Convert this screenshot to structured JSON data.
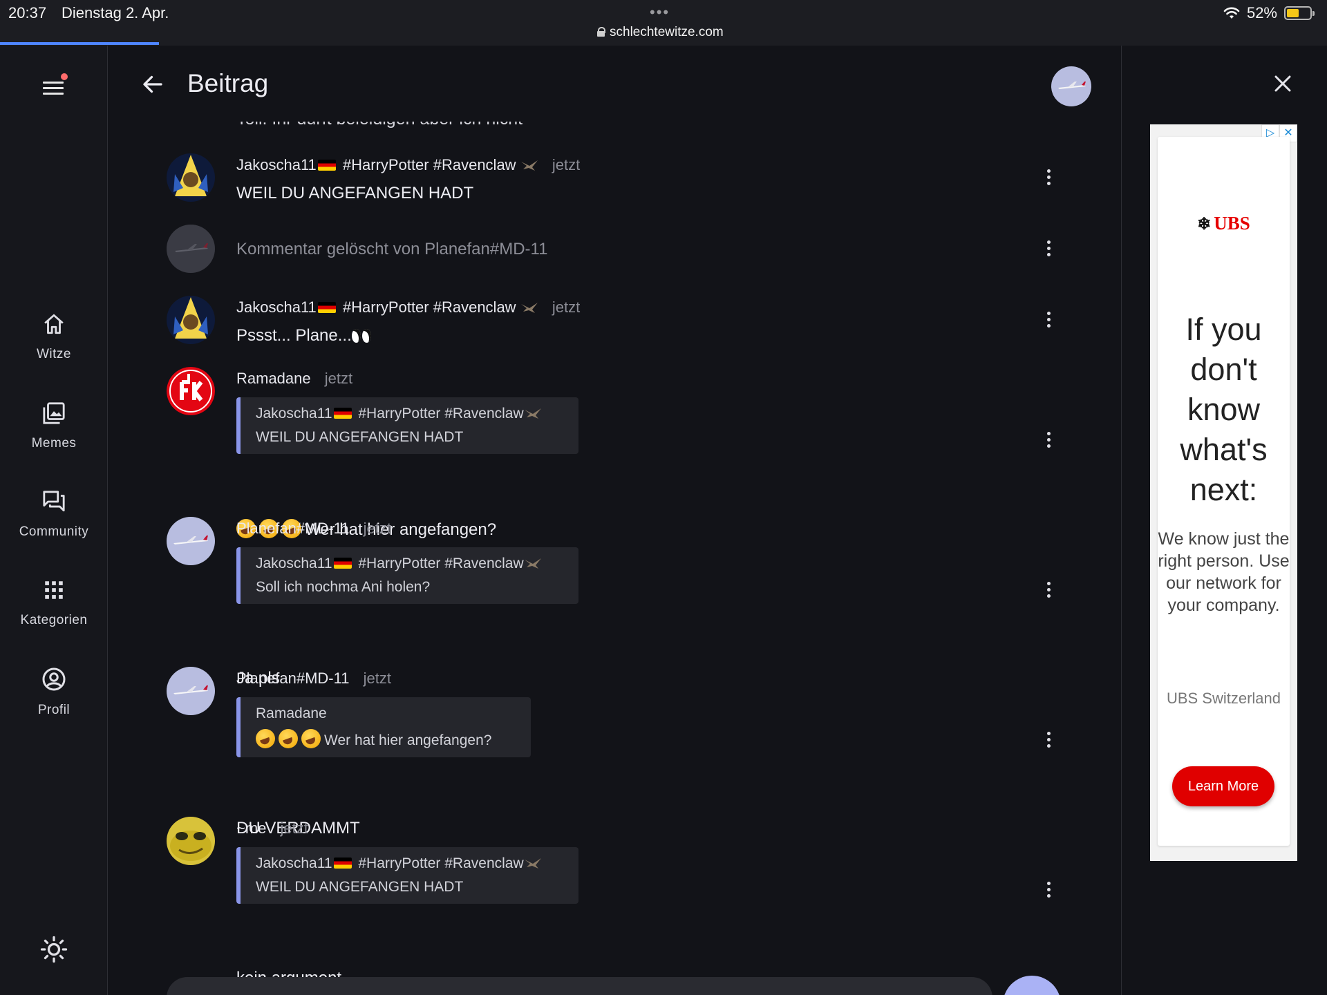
{
  "status_bar": {
    "time": "20:37",
    "date": "Dienstag 2. Apr.",
    "dots": "•••",
    "url": "schlechtewitze.com",
    "battery": "52%"
  },
  "nav": {
    "items": [
      {
        "label": "Witze",
        "icon": "home-icon"
      },
      {
        "label": "Memes",
        "icon": "image-gallery-icon"
      },
      {
        "label": "Community",
        "icon": "forum-icon"
      },
      {
        "label": "Kategorien",
        "icon": "apps-grid-icon"
      },
      {
        "label": "Profil",
        "icon": "account-circle-icon"
      }
    ]
  },
  "header": {
    "title": "Beitrag"
  },
  "partial_text": "Toll. Ihr dürft beleidigen aber ich nicht",
  "comments": [
    {
      "author": "Jakoscha11",
      "tags": "#HarryPotter #Ravenclaw",
      "time": "jetzt",
      "text": "WEIL DU ANGEFANGEN HADT"
    },
    {
      "deleted_text": "Kommentar gelöscht von Planefan#MD-11"
    },
    {
      "author": "Jakoscha11",
      "tags": "#HarryPotter #Ravenclaw",
      "time": "jetzt",
      "text": "Pssst... Plane..."
    },
    {
      "author": "Ramadane",
      "time": "jetzt",
      "quote_author": "Jakoscha11",
      "quote_tags": "#HarryPotter #Ravenclaw",
      "quote_text": "WEIL DU ANGEFANGEN HADT",
      "text": "Wer hat hier angefangen?"
    },
    {
      "author": "Planefan#MD-11",
      "time": "jetzt",
      "quote_author": "Jakoscha11",
      "quote_tags": "#HarryPotter #Ravenclaw",
      "quote_text": "Soll ich nochma Ani holen?",
      "text": "Ja pls"
    },
    {
      "author": "Planefan#MD-11",
      "time": "jetzt",
      "quote_author": "Ramadane",
      "quote_text": "Wer hat hier angefangen?",
      "text": "DU VERDAMMT"
    },
    {
      "author": "~me",
      "time": "jetzt",
      "quote_author": "Jakoscha11",
      "quote_tags": "#HarryPotter #Ravenclaw",
      "quote_text": "WEIL DU ANGEFANGEN HADT",
      "text": "kein argument"
    }
  ],
  "ad": {
    "brand": "UBS",
    "headline": "If you don't know what's next:",
    "body": "We know just the right person. Use our network for your company.",
    "source": "UBS Switzerland",
    "cta": "Learn More",
    "brand_color": "#e60000"
  },
  "colors": {
    "background": "#121318",
    "accent": "#8a95e8",
    "quote_bg": "#25262c"
  }
}
